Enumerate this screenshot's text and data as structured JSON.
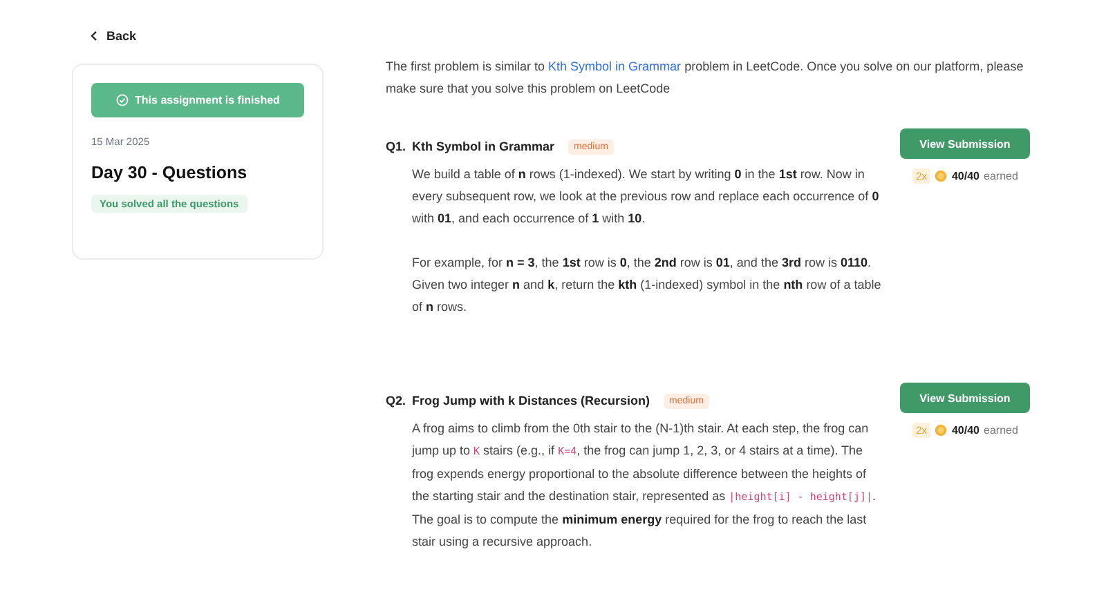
{
  "back": {
    "label": "Back"
  },
  "card": {
    "status": "This assignment is finished",
    "date": "15 Mar 2025",
    "title": "Day 30 - Questions",
    "badge": "You solved all the questions"
  },
  "intro": [
    {
      "kind": "text",
      "text": "The first problem is similar to "
    },
    {
      "kind": "link",
      "text": "Kth Symbol in Grammar"
    },
    {
      "kind": "text",
      "text": " problem in LeetCode. Once you solve on our platform, please make sure that you solve this problem on LeetCode"
    }
  ],
  "questions": [
    {
      "number": "Q1.",
      "title": "Kth Symbol in Grammar",
      "difficulty": "medium",
      "button": "View Submission",
      "multiplier": "2x",
      "score": "40/40",
      "earned": "earned",
      "paragraphs": [
        [
          {
            "kind": "text",
            "text": "We build a table of **n** rows (1-indexed). We start by writing **0** in the **1st** row. Now in every subsequent row, we look at the previous row and replace each occurrence of **0** with **01**, and each occurrence of **1** with **10**."
          }
        ],
        [
          {
            "kind": "text",
            "text": "For example, for **n = 3**, the **1st** row is **0**, the **2nd** row is **01**, and the **3rd** row is **0110**. Given two integer **n** and **k**, return the **kth** (1-indexed) symbol in the **nth** row of a table of **n** rows."
          }
        ]
      ]
    },
    {
      "number": "Q2.",
      "title": "Frog Jump with k Distances (Recursion)",
      "difficulty": "medium",
      "button": "View Submission",
      "multiplier": "2x",
      "score": "40/40",
      "earned": "earned",
      "paragraphs": [
        [
          {
            "kind": "text",
            "text": "A frog aims to climb from the 0th stair to the (N-1)th stair. At each step, the frog can jump up to "
          },
          {
            "kind": "code",
            "text": "K"
          },
          {
            "kind": "text",
            "text": " stairs (e.g., if "
          },
          {
            "kind": "code",
            "text": "K=4"
          },
          {
            "kind": "text",
            "text": ", the frog can jump 1, 2, 3, or 4 stairs at a time). The frog expends energy proportional to the absolute difference between the heights of the starting stair and the destination stair, represented as "
          },
          {
            "kind": "code",
            "text": "|height[i] - height[j]|"
          },
          {
            "kind": "text",
            "text": ". The goal is to compute the **minimum energy** required for the frog to reach the last stair using a recursive approach."
          }
        ]
      ]
    }
  ]
}
